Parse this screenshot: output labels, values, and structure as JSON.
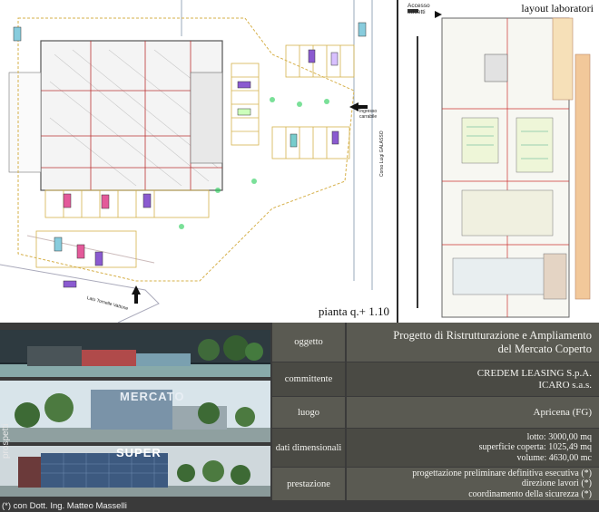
{
  "plan": {
    "title": "pianta q.+ 1.10",
    "annotations": {
      "street_corso": "Corso Luigi GALASSO",
      "street_largo": "Lato Tornelle Vattone",
      "ingresso": "Ingresso carrabile"
    }
  },
  "lab": {
    "title": "layout laboratori",
    "accesso": "Accesso addetti"
  },
  "prospetti": {
    "label": "prospetti",
    "sign_mercato": "MERCATO",
    "sign_super": "SUPER"
  },
  "table": {
    "rows": [
      {
        "label": "oggetto",
        "lines": [
          "Progetto di Ristrutturazione e Ampliamento",
          "del Mercato Coperto"
        ]
      },
      {
        "label": "committente",
        "lines": [
          "CREDEM LEASING S.p.A.",
          "ICARO s.a.s."
        ]
      },
      {
        "label": "luogo",
        "lines": [
          "Apricena (FG)"
        ]
      },
      {
        "label": "dati dimensionali",
        "lines": [
          "lotto: 3000,00 mq",
          "superficie coperta: 1025,49 mq",
          "volume: 4630,00 mc"
        ]
      },
      {
        "label": "prestazione",
        "lines": [
          "progettazione preliminare definitiva esecutiva (*)",
          "direzione lavori (*)",
          "coordinamento della sicurezza (*)"
        ]
      }
    ]
  },
  "footnote": "(*) con Dott. Ing. Matteo Masselli"
}
